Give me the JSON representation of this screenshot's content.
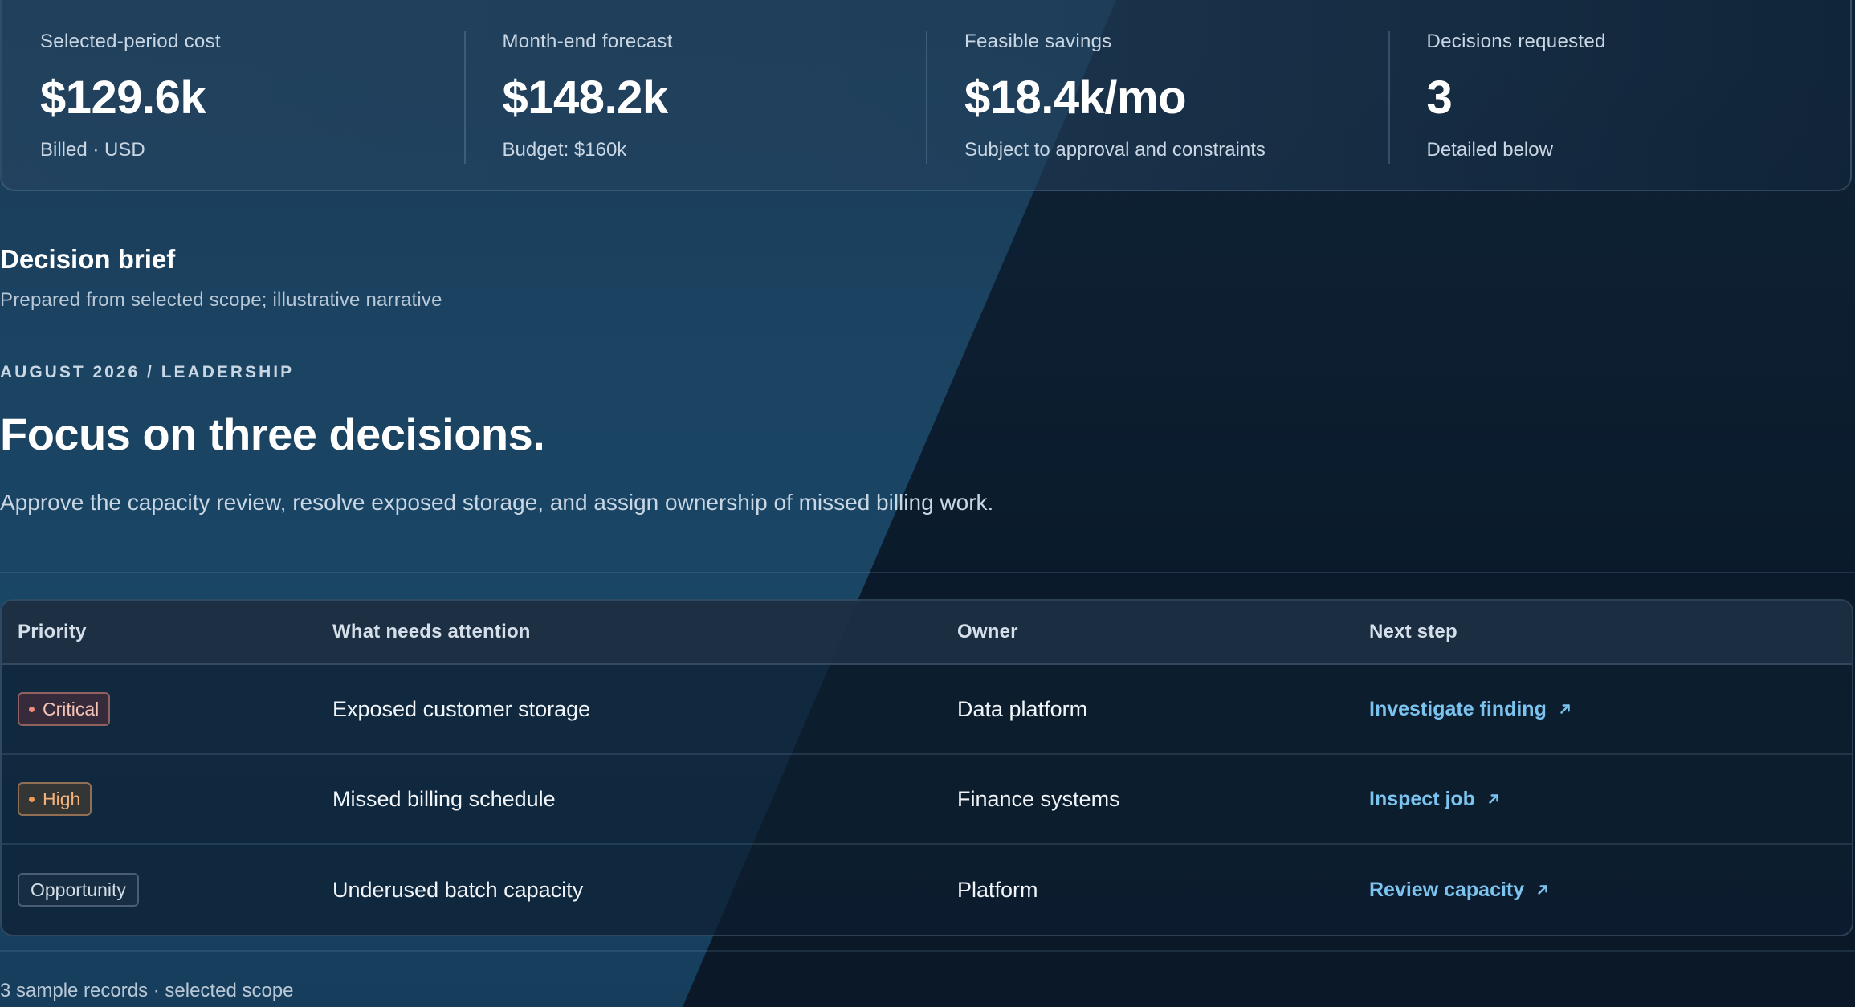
{
  "kpis": [
    {
      "label": "Selected-period cost",
      "value": "$129.6k",
      "sub": "Billed · USD"
    },
    {
      "label": "Month-end forecast",
      "value": "$148.2k",
      "sub": "Budget: $160k"
    },
    {
      "label": "Feasible savings",
      "value": "$18.4k/mo",
      "sub": "Subject to approval and constraints"
    },
    {
      "label": "Decisions requested",
      "value": "3",
      "sub": "Detailed below"
    }
  ],
  "brief": {
    "title": "Decision brief",
    "subtitle": "Prepared from selected scope; illustrative narrative",
    "eyebrow": "AUGUST 2026 / LEADERSHIP",
    "headline": "Focus on three decisions.",
    "summary": "Approve the capacity review, resolve exposed storage, and assign ownership of missed billing work."
  },
  "table": {
    "headers": {
      "priority": "Priority",
      "attention": "What needs attention",
      "owner": "Owner",
      "next": "Next step"
    },
    "rows": [
      {
        "priority": "Critical",
        "attention": "Exposed customer storage",
        "owner": "Data platform",
        "next": "Investigate finding"
      },
      {
        "priority": "High",
        "attention": "Missed billing schedule",
        "owner": "Finance systems",
        "next": "Inspect job"
      },
      {
        "priority": "Opportunity",
        "attention": "Underused batch capacity",
        "owner": "Platform",
        "next": "Review capacity"
      }
    ]
  },
  "footer": {
    "note": "3 sample records · selected scope"
  },
  "colors": {
    "critical": "#f08a7a",
    "high": "#f09a55",
    "link": "#7cc4f0"
  },
  "icons": {
    "external_link": "arrow-up-right-icon",
    "status_dot": "dot-icon"
  }
}
